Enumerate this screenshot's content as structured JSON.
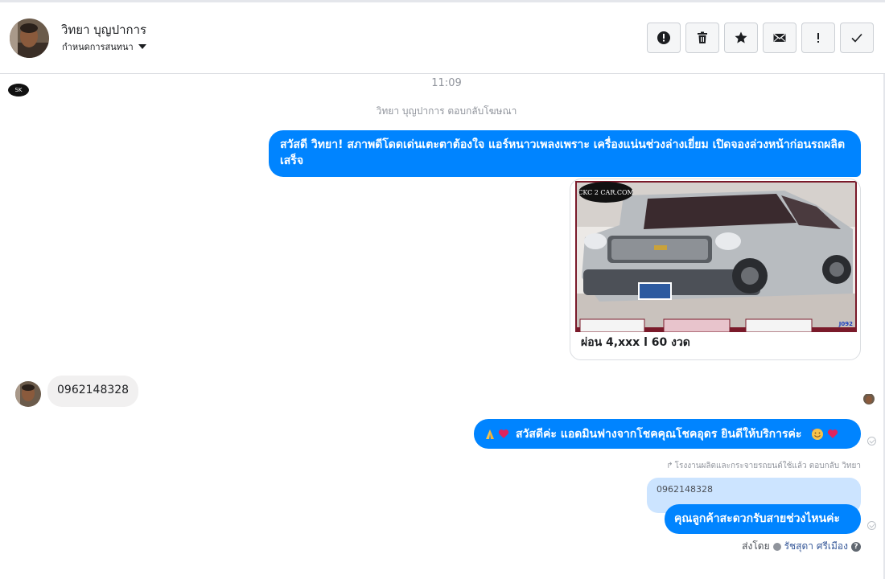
{
  "header": {
    "contact_name": "วิทยา บุญปาการ",
    "assign_label": "กำหนดการสนทนา",
    "actions": [
      {
        "name": "spam-button",
        "icon": "alert-circle-icon"
      },
      {
        "name": "delete-button",
        "icon": "trash-icon"
      },
      {
        "name": "star-button",
        "icon": "star-icon"
      },
      {
        "name": "mark-unread-button",
        "icon": "envelope-icon"
      },
      {
        "name": "follow-up-button",
        "icon": "exclamation-icon"
      },
      {
        "name": "mark-done-button",
        "icon": "check-icon"
      }
    ]
  },
  "conversation": {
    "time": "11:09",
    "reply_note": "วิทยา บุญปาการ ตอบกลับโฆษณา",
    "msg1": "สวัสดี วิทยา! สภาพดีโดดเด่นเตะตาต้องใจ แอร์หนาวเพลงเพราะ เครื่องแน่นช่วงล่างเยี่ยม เปิดจองล่วงหน้าก่อนรถผลิตเสร็จ",
    "card": {
      "title": "ผ่อน 4,xxx l 60 งวด",
      "image_logo_text": "CKC 2 CAR.COM",
      "image_code": "J092"
    },
    "incoming": "0962148328",
    "msg2": "สวัสดีค่ะ แอดมินฟางจากโชคคุณโชคอุดร ยินดีให้บริการค่ะ",
    "reply_meta": "โรงงานผลิตและกระจายรถยนต์ใช้แล้ว ตอบกลับ วิทยา",
    "quoted": "0962148328",
    "msg3": "คุณลูกค้าสะดวกรับสายช่วงไหนค่ะ",
    "sent_by_label": "ส่งโดย",
    "sent_by_name": "รัชสุดา ศรีเมือง"
  },
  "colors": {
    "accent": "#0084ff",
    "incoming_bubble": "#f1f0f0",
    "quoted_bubble": "#cce4ff"
  }
}
